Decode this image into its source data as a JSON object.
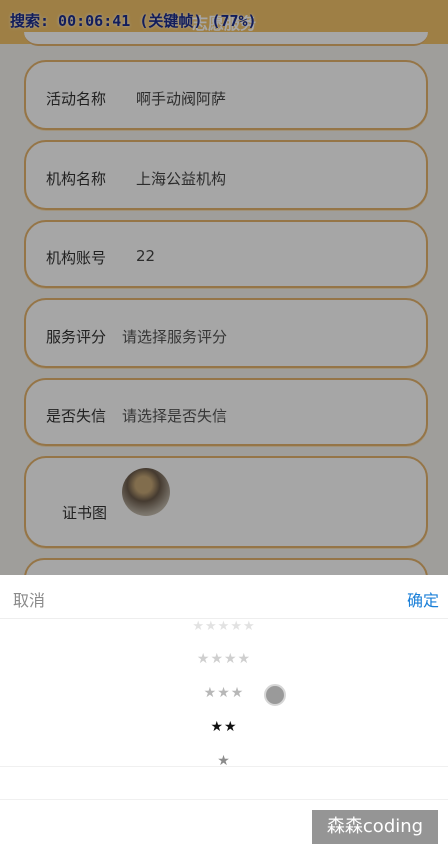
{
  "header": {
    "title": "志愿服务",
    "debug_text": "搜索: 00:06:41 (关键帧) (77%)"
  },
  "form": {
    "activity": {
      "label": "活动名称",
      "value": "啊手动阀阿萨"
    },
    "org_name": {
      "label": "机构名称",
      "value": "上海公益机构"
    },
    "org_account": {
      "label": "机构账号",
      "value": "22"
    },
    "rating": {
      "label": "服务评分",
      "placeholder": "请选择服务评分"
    },
    "dishonest": {
      "label": "是否失信",
      "placeholder": "请选择是否失信"
    },
    "certificate": {
      "label": "证书图"
    }
  },
  "picker": {
    "cancel": "取消",
    "confirm": "确定",
    "options": [
      "★★★★★",
      "★★★★",
      "★★★",
      "★★",
      "★"
    ],
    "selected": "★★"
  },
  "watermark": "森森coding",
  "colors": {
    "header_bg": "#f3c46a",
    "card_border": "#e5b46e",
    "confirm_blue": "#1a7fd8",
    "debug_text": "#1d2d8c"
  }
}
